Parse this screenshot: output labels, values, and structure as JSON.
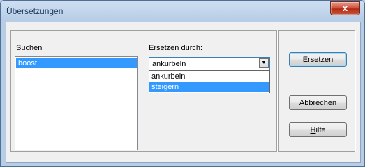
{
  "window": {
    "title": "Übersetzungen",
    "close_symbol": "x"
  },
  "search": {
    "label_accel": "u",
    "label": "Suchen",
    "items": [
      "boost"
    ]
  },
  "replace": {
    "label_accel": "t",
    "label": "Ersetzen durch:",
    "selected_value": "ankurbeln",
    "options": [
      "ankurbeln",
      "steigern"
    ],
    "highlighted_option": "steigern"
  },
  "buttons": {
    "replace": {
      "label": "Ersetzen",
      "accel": "E"
    },
    "cancel": {
      "label": "Abbrechen",
      "accel": "b"
    },
    "help": {
      "label": "Hilfe",
      "accel": "H"
    }
  }
}
